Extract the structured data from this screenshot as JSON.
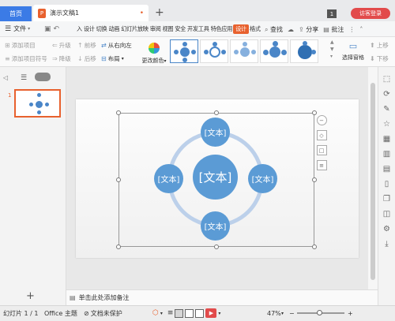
{
  "titlebar": {
    "home_tab": "首页",
    "doc_tab": "演示文稿1",
    "doc_icon": "P",
    "close": "•",
    "add_tab": "+",
    "badge": "1",
    "login": "访客登录"
  },
  "menubar": {
    "file": "文件",
    "tabs": [
      "入",
      "设计",
      "切换",
      "动画",
      "幻灯片放映",
      "审阅",
      "视图",
      "安全",
      "开发工具",
      "特色应用",
      "设计",
      "格式"
    ],
    "active_tab": "设计",
    "search": "查找",
    "share": "分享",
    "annotate": "批注"
  },
  "ribbon": {
    "add_item": "添加项目",
    "add_bullet": "添加项目符号",
    "upgrade": "升级",
    "downgrade": "降级",
    "move_forward": "前移",
    "move_back": "后移",
    "rtl": "从右向左",
    "layout": "布局",
    "change_color": "更改颜色",
    "select_pane": "选择窗格",
    "up": "上移",
    "down": "下移"
  },
  "slides_panel": {
    "slide_number": "1"
  },
  "diagram": {
    "center_text": "[文本]",
    "top_text": "[文本]",
    "left_text": "[文本]",
    "right_text": "[文本]",
    "bottom_text": "[文本]"
  },
  "notes": {
    "placeholder": "单击此处添加备注"
  },
  "statusbar": {
    "slide_info": "幻灯片 1 / 1",
    "theme": "Office 主题",
    "doc_protect": "文档未保护",
    "zoom": "47%",
    "zoom_fraction": 0.47
  },
  "colors": {
    "accent": "#e8612e",
    "brand_blue": "#3b7be6",
    "node_fill": "#5b9bd5",
    "ring": "#bcd0ea"
  }
}
